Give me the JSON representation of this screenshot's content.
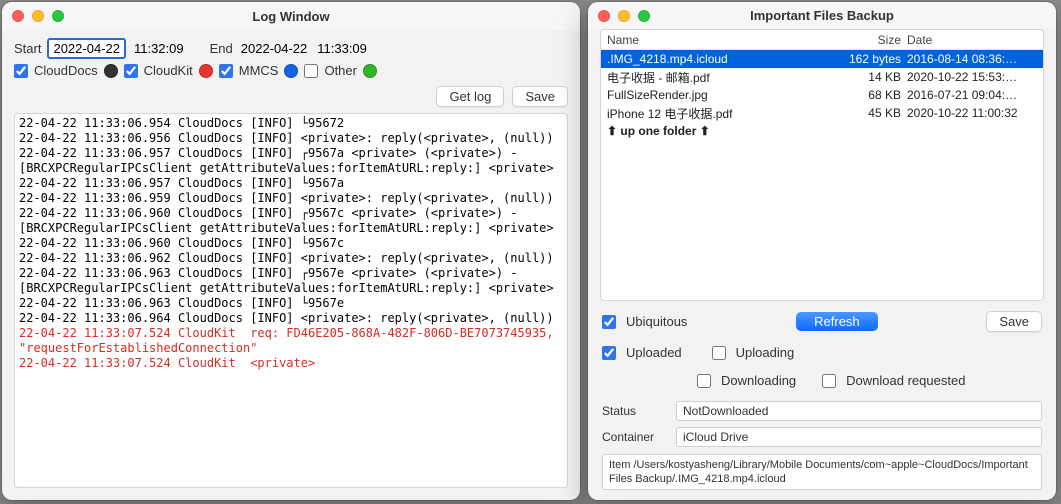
{
  "logWindow": {
    "title": "Log Window",
    "startLabel": "Start",
    "startDate": "2022-04-22",
    "startTime": "11:32:09",
    "endLabel": "End",
    "endDate": "2022-04-22",
    "endTime": "11:33:09",
    "filters": {
      "cloudDocs": "CloudDocs",
      "cloudDocsChecked": true,
      "cloudKit": "CloudKit",
      "cloudKitChecked": true,
      "mmcs": "MMCS",
      "mmcsChecked": true,
      "other": "Other",
      "otherChecked": false
    },
    "getLogBtn": "Get log",
    "saveBtn": "Save",
    "lines": [
      {
        "t": "22-04-22 11:33:06.954 CloudDocs [INFO] └95672",
        "c": ""
      },
      {
        "t": "22-04-22 11:33:06.956 CloudDocs [INFO] <private>: reply(<private>, (null))",
        "c": ""
      },
      {
        "t": "22-04-22 11:33:06.957 CloudDocs [INFO] ┌9567a <private> (<private>) - [BRCXPCRegularIPCsClient getAttributeValues:forItemAtURL:reply:] <private>",
        "c": ""
      },
      {
        "t": "22-04-22 11:33:06.957 CloudDocs [INFO] └9567a",
        "c": ""
      },
      {
        "t": "22-04-22 11:33:06.959 CloudDocs [INFO] <private>: reply(<private>, (null))",
        "c": ""
      },
      {
        "t": "22-04-22 11:33:06.960 CloudDocs [INFO] ┌9567c <private> (<private>) - [BRCXPCRegularIPCsClient getAttributeValues:forItemAtURL:reply:] <private>",
        "c": ""
      },
      {
        "t": "22-04-22 11:33:06.960 CloudDocs [INFO] └9567c",
        "c": ""
      },
      {
        "t": "22-04-22 11:33:06.962 CloudDocs [INFO] <private>: reply(<private>, (null))",
        "c": ""
      },
      {
        "t": "22-04-22 11:33:06.963 CloudDocs [INFO] ┌9567e <private> (<private>) - [BRCXPCRegularIPCsClient getAttributeValues:forItemAtURL:reply:] <private>",
        "c": ""
      },
      {
        "t": "22-04-22 11:33:06.963 CloudDocs [INFO] └9567e",
        "c": ""
      },
      {
        "t": "22-04-22 11:33:06.964 CloudDocs [INFO] <private>: reply(<private>, (null))",
        "c": ""
      },
      {
        "t": "22-04-22 11:33:07.524 CloudKit  req: FD46E205-868A-482F-806D-BE7073745935, \"requestForEstablishedConnection\"",
        "c": "cdk"
      },
      {
        "t": "22-04-22 11:33:07.524 CloudKit  <private>",
        "c": "cdk"
      }
    ]
  },
  "filesWindow": {
    "title": "Important Files Backup",
    "columns": {
      "name": "Name",
      "size": "Size",
      "date": "Date"
    },
    "rows": [
      {
        "name": ".IMG_4218.mp4.icloud",
        "size": "162 bytes",
        "date": "2016-08-14 08:36:…",
        "sel": true
      },
      {
        "name": "电子收据 - 邮箱.pdf",
        "size": "14 KB",
        "date": "2020-10-22 15:53:…",
        "sel": false
      },
      {
        "name": "FullSizeRender.jpg",
        "size": "68 KB",
        "date": "2016-07-21 09:04:…",
        "sel": false
      },
      {
        "name": "iPhone 12 电子收据.pdf",
        "size": "45 KB",
        "date": "2020-10-22 11:00:32",
        "sel": false
      }
    ],
    "upOne": "⬆ up one folder ⬆",
    "ubiquitous": "Ubiquitous",
    "uploaded": "Uploaded",
    "uploading": "Uploading",
    "downloading": "Downloading",
    "downloadRequested": "Download requested",
    "refreshBtn": "Refresh",
    "saveBtn": "Save",
    "statusLabel": "Status",
    "statusValue": "NotDownloaded",
    "containerLabel": "Container",
    "containerValue": "iCloud Drive",
    "itemPath": "Item /Users/kostyasheng/Library/Mobile Documents/com~apple~CloudDocs/Important Files Backup/.IMG_4218.mp4.icloud"
  }
}
